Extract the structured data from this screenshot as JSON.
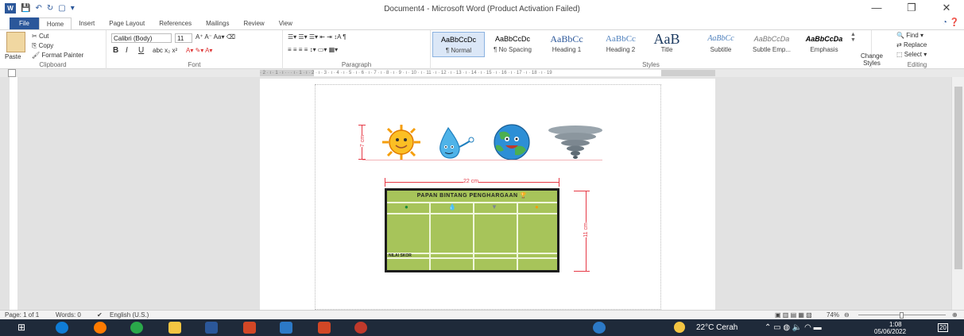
{
  "window": {
    "title": "Document4 - Microsoft Word (Product Activation Failed)",
    "controls": [
      "—",
      "❐",
      "✕"
    ]
  },
  "tabs": [
    "File",
    "Home",
    "Insert",
    "Page Layout",
    "References",
    "Mailings",
    "Review",
    "View"
  ],
  "active_tab": "Home",
  "ribbon": {
    "clipboard": {
      "label": "Clipboard",
      "paste": "Paste",
      "cut": "Cut",
      "copy": "Copy",
      "format_painter": "Format Painter"
    },
    "font": {
      "label": "Font",
      "name": "Calibri (Body)",
      "size": "11"
    },
    "paragraph": {
      "label": "Paragraph"
    },
    "styles": {
      "label": "Styles",
      "items": [
        {
          "preview": "AaBbCcDc",
          "name": "¶ Normal"
        },
        {
          "preview": "AaBbCcDc",
          "name": "¶ No Spacing"
        },
        {
          "preview": "AaBbCc",
          "name": "Heading 1"
        },
        {
          "preview": "AaBbCc",
          "name": "Heading 2"
        },
        {
          "preview": "AaB",
          "name": "Title"
        },
        {
          "preview": "AaBbCc",
          "name": "Subtitle"
        },
        {
          "preview": "AaBbCcDa",
          "name": "Subtle Emp..."
        },
        {
          "preview": "AaBbCcDa",
          "name": "Emphasis"
        }
      ],
      "change_styles": "Change Styles"
    },
    "editing": {
      "label": "Editing",
      "find": "Find",
      "replace": "Replace",
      "select": "Select"
    }
  },
  "ruler_text": "· 2 · ı · 1 · ı · · · ı · 1 · ı · 2 · ı · 3 · ı · 4 · ı · 5 · ı · 6 · ı · 7 · ı · 8 · ı · 9 · ı · 10 · ı · 11 · ı · 12 · ı · 13 · ı · 14 · ı · 15 · ı · 16 · ı · 17 · ı · 18 · ı · 19",
  "document": {
    "strip_height_label": "7 cm",
    "board_width_label": "22 cm",
    "board_height_label": "11 cm",
    "board_title": "PAPAN BINTANG PENGHARGAAN",
    "board_row_label": "NILAI SKOR"
  },
  "status": {
    "page": "Page: 1 of 1",
    "words": "Words: 0",
    "language": "English (U.S.)",
    "zoom": "74%"
  },
  "taskbar": {
    "weather": "22°C Cerah",
    "time": "1:08",
    "date": "05/06/2022",
    "notifications": "20"
  },
  "colors": {
    "word_blue": "#2b579a",
    "board_green": "#a7c45a",
    "dimension_red": "#e63946"
  }
}
